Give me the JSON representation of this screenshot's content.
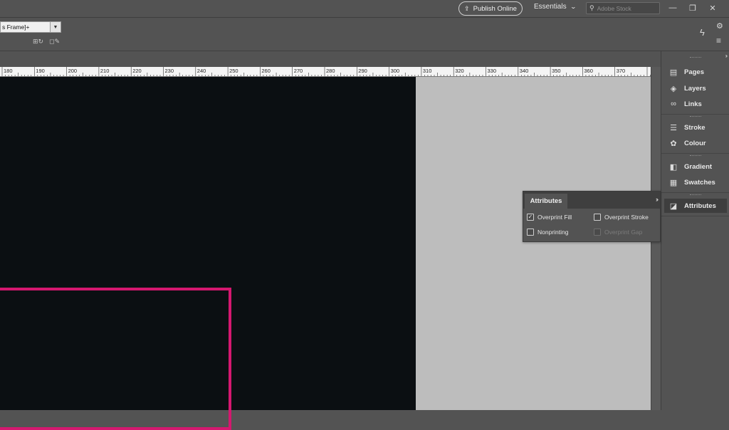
{
  "appbar": {
    "publish_label": "Publish Online",
    "workspace_label": "Essentials",
    "stock_placeholder": "Adobe Stock",
    "window_controls": [
      "minimize",
      "restore",
      "close"
    ]
  },
  "control_bar": {
    "frame_style_value": "s Frame]+"
  },
  "ruler": {
    "labels": [
      "180",
      "190",
      "200",
      "210",
      "220",
      "230",
      "240",
      "250",
      "260",
      "270",
      "280",
      "290",
      "300",
      "310",
      "320",
      "330",
      "340",
      "350",
      "360",
      "370"
    ]
  },
  "dock": {
    "items": [
      {
        "label": "Pages",
        "icon": "pages-icon"
      },
      {
        "label": "Layers",
        "icon": "layers-icon"
      },
      {
        "label": "Links",
        "icon": "links-icon"
      },
      {
        "label": "Stroke",
        "icon": "stroke-icon"
      },
      {
        "label": "Colour",
        "icon": "colour-icon"
      },
      {
        "label": "Gradient",
        "icon": "gradient-icon"
      },
      {
        "label": "Swatches",
        "icon": "swatches-icon"
      },
      {
        "label": "Attributes",
        "icon": "attributes-icon"
      }
    ]
  },
  "attributes_panel": {
    "tab_label": "Attributes",
    "options": [
      {
        "label": "Overprint Fill",
        "checked": true,
        "enabled": true
      },
      {
        "label": "Overprint Stroke",
        "checked": false,
        "enabled": true
      },
      {
        "label": "Nonprinting",
        "checked": false,
        "enabled": true
      },
      {
        "label": "Overprint Gap",
        "checked": false,
        "enabled": false
      }
    ]
  },
  "colors": {
    "frame_stroke": "#d4186f",
    "page_fill": "#0b0f12",
    "pasteboard": "#bdbdbd"
  }
}
